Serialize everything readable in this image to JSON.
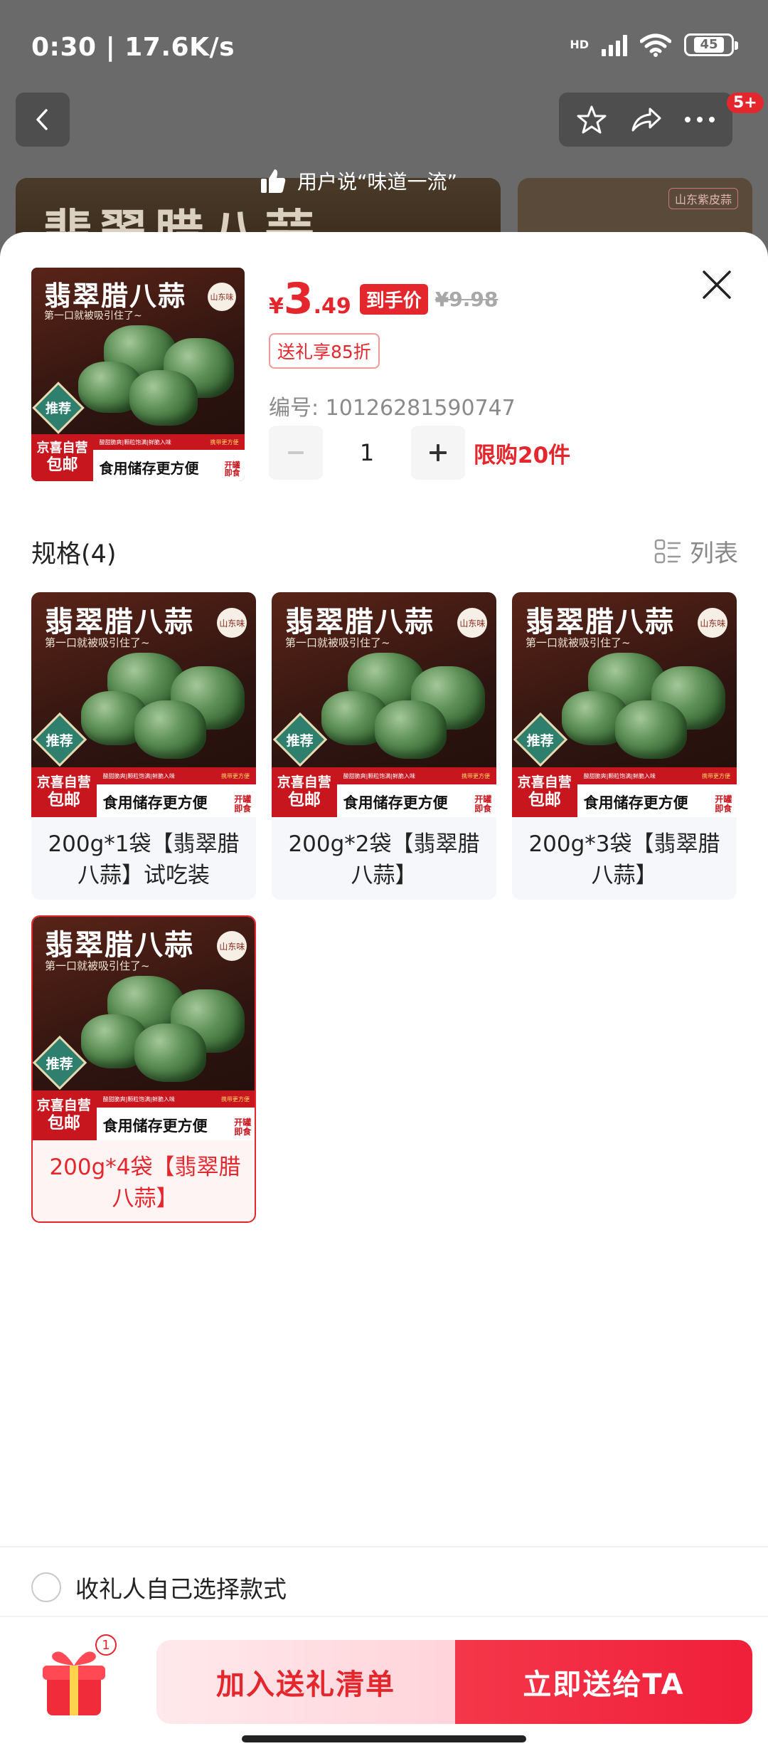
{
  "status_bar": {
    "time": "0:30 | 17.6K/s",
    "network": "HD",
    "battery": "45"
  },
  "header": {
    "badge": "5+",
    "user_says": "用户说“味道一流”",
    "side_image_tag": "山东紫皮蒜"
  },
  "product": {
    "thumb_title": "翡翠腊八蒜",
    "thumb_region": "山东味",
    "thumb_sub": "第一口就被吸引住了~",
    "thumb_recommend": "推荐",
    "thumb_jd_line1": "京喜自营",
    "thumb_jd_line2": "包邮",
    "thumb_tags": "酸甜脆爽|颗粒饱满|鲜脆入味",
    "thumb_tag_right": "携带更方便",
    "thumb_slogan": "食用储存更方便",
    "thumb_open1": "开罐",
    "thumb_open2": "即食",
    "currency": "¥",
    "price_int": "3",
    "price_dec": ".49",
    "price_tag": "到手价",
    "original_price": "¥9.98",
    "gift_discount": "送礼享85折",
    "sku_number": "编号: 10126281590747",
    "quantity": "1",
    "limit": "限购20件"
  },
  "specs": {
    "title": "规格(4)",
    "view_toggle": "列表",
    "options": [
      {
        "label": "200g*1袋【翡翠腊八蒜】试吃装",
        "selected": false
      },
      {
        "label": "200g*2袋【翡翠腊八蒜】",
        "selected": false
      },
      {
        "label": "200g*3袋【翡翠腊八蒜】",
        "selected": false
      },
      {
        "label": "200g*4袋【翡翠腊八蒜】",
        "selected": true
      }
    ]
  },
  "recipient_choice": {
    "label": "收礼人自己选择款式"
  },
  "footer": {
    "gift_count": "1",
    "add_to_list": "加入送礼清单",
    "send_now": "立即送给TA"
  },
  "colors": {
    "accent": "#e4262d",
    "accent_light": "#ffd4da",
    "muted": "#8a8a8a"
  },
  "icons": [
    "back-icon",
    "star-icon",
    "share-icon",
    "more-icon",
    "thumbs-up-icon",
    "close-icon",
    "minus-icon",
    "plus-icon",
    "list-view-icon",
    "gift-box-icon"
  ]
}
